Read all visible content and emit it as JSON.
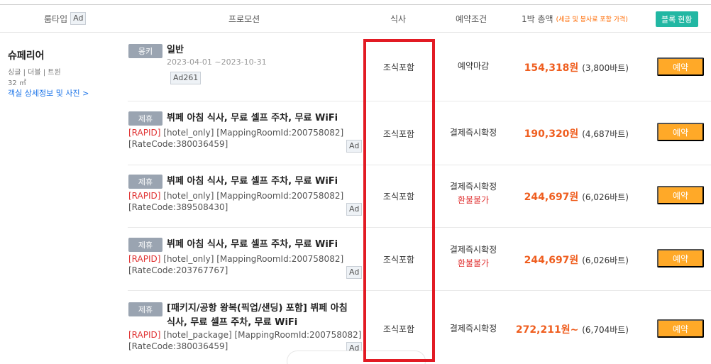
{
  "header": {
    "room_type": "룸타입",
    "ad": "Ad",
    "promotion": "프로모션",
    "meal": "식사",
    "condition": "예약조건",
    "price": "1박 총액",
    "price_note": "(세금 및 봉사료 포함 가격)",
    "block_status": "블록 현황"
  },
  "room": {
    "name": "슈페리어",
    "beds": "싱글 | 더블 | 트윈",
    "size": "32 ㎡",
    "detail_link": "객실 상세정보 및 사진 >"
  },
  "rates": [
    {
      "badge": "몽키",
      "title": "일반",
      "period": "2023-04-01 ~2023-10-31",
      "ad": "Ad261",
      "meal": "조식포함",
      "condition": "예약마감",
      "price": "154,318원",
      "price_sub": "(3,800바트)",
      "book": "예약"
    },
    {
      "badge": "제휴",
      "title": "뷔페 아침 식사, 무료 셀프 주차, 무료 WiFi",
      "rapid": "[RAPID]",
      "code_line1": " [hotel_only] [MappingRoomId:200758082]",
      "code_line2": "[RateCode:380036459]",
      "ad": "Ad",
      "meal": "조식포함",
      "condition": "결제즉시확정",
      "price": "190,320원",
      "price_sub": "(4,687바트)",
      "book": "예약"
    },
    {
      "badge": "제휴",
      "title": "뷔페 아침 식사, 무료 셀프 주차, 무료 WiFi",
      "rapid": "[RAPID]",
      "code_line1": " [hotel_only] [MappingRoomId:200758082]",
      "code_line2": "[RateCode:389508430]",
      "ad": "Ad",
      "meal": "조식포함",
      "condition": "결제즉시확정",
      "condition_note": "환불불가",
      "price": "244,697원",
      "price_sub": "(6,026바트)",
      "book": "예약"
    },
    {
      "badge": "제휴",
      "title": "뷔페 아침 식사, 무료 셀프 주차, 무료 WiFi",
      "rapid": "[RAPID]",
      "code_line1": " [hotel_only] [MappingRoomId:200758082]",
      "code_line2": "[RateCode:203767767]",
      "ad": "Ad",
      "meal": "조식포함",
      "condition": "결제즉시확정",
      "condition_note": "환불불가",
      "price": "244,697원",
      "price_sub": "(6,026바트)",
      "book": "예약"
    },
    {
      "badge": "제휴",
      "title_line1": "[패키지/공항 왕복(픽업/샌딩) 포함] 뷔페 아침",
      "title_line2": "식사, 무료 셀프 주차, 무료 WiFi",
      "rapid": "[RAPID]",
      "code_line1": " [hotel_package] [MappingRoomId:200758082]",
      "code_line2": "[RateCode:380036459]",
      "ad": "Ad",
      "meal": "조식포함",
      "condition": "결제즉시확정",
      "price": "272,211원~",
      "price_sub": "(6,704바트)",
      "book": "예약"
    }
  ],
  "colors": {
    "highlight": "#e21b24",
    "price": "#ef5e1f",
    "book_button": "#ffa928",
    "block_button": "#22b7a3",
    "non_refundable": "#e03333"
  }
}
